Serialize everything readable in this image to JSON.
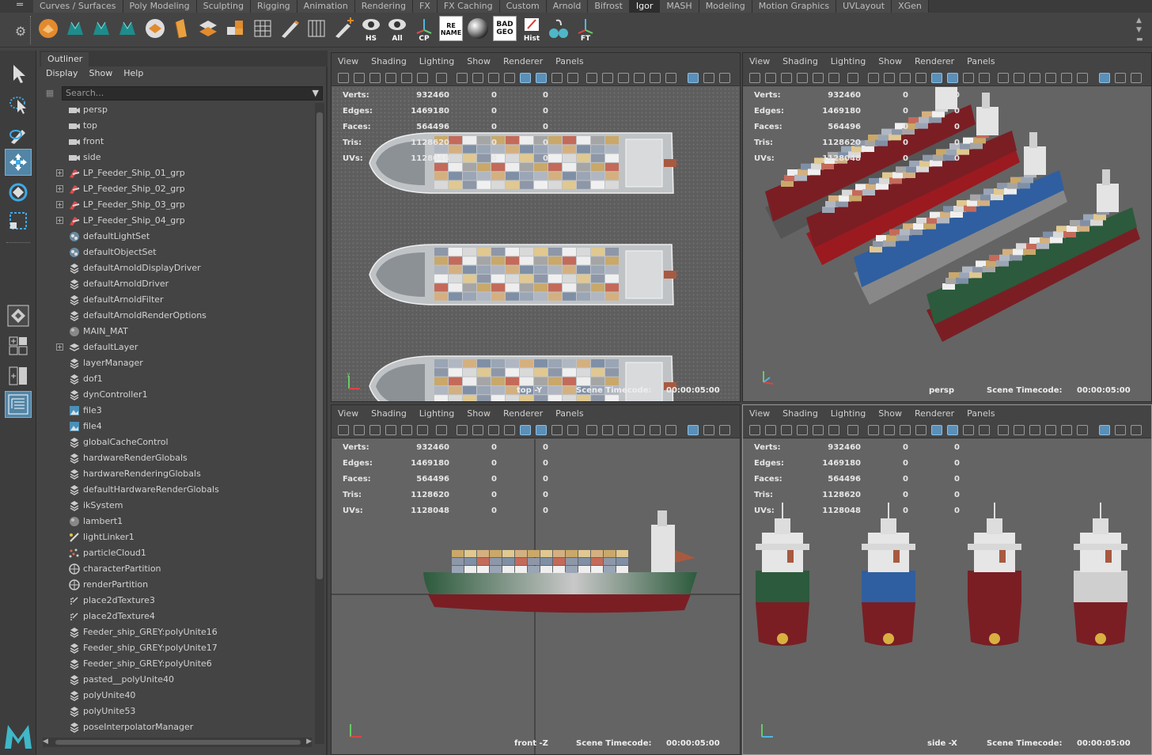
{
  "shelf": {
    "tabs": [
      "Curves / Surfaces",
      "Poly Modeling",
      "Sculpting",
      "Rigging",
      "Animation",
      "Rendering",
      "FX",
      "FX Caching",
      "Custom",
      "Arnold",
      "Bifrost",
      "Igor",
      "MASH",
      "Modeling",
      "Motion Graphics",
      "UVLayout",
      "XGen"
    ],
    "active_tab": "Igor",
    "buttons": [
      {
        "name": "shelf-icon-1",
        "label": ""
      },
      {
        "name": "shelf-icon-2",
        "label": ""
      },
      {
        "name": "shelf-icon-3",
        "label": ""
      },
      {
        "name": "shelf-icon-4",
        "label": ""
      },
      {
        "name": "shelf-icon-5",
        "label": ""
      },
      {
        "name": "shelf-icon-6",
        "label": ""
      },
      {
        "name": "shelf-icon-7",
        "label": ""
      },
      {
        "name": "shelf-icon-8",
        "label": ""
      },
      {
        "name": "shelf-icon-9",
        "label": ""
      },
      {
        "name": "shelf-icon-10",
        "label": ""
      },
      {
        "name": "shelf-icon-11",
        "label": ""
      },
      {
        "name": "shelf-icon-12",
        "label": ""
      }
    ],
    "labeled": {
      "hs": "HS",
      "all": "All",
      "cp": "CP",
      "rename": "RE NAME",
      "badgeo": "BAD GEO",
      "hist": "Hist",
      "ft": "FT"
    }
  },
  "outliner": {
    "title": "Outliner",
    "menu": [
      "Display",
      "Show",
      "Help"
    ],
    "search_placeholder": "Search...",
    "items": [
      {
        "label": "persp",
        "icon": "camera",
        "expand": false
      },
      {
        "label": "top",
        "icon": "camera",
        "expand": false
      },
      {
        "label": "front",
        "icon": "camera",
        "expand": false
      },
      {
        "label": "side",
        "icon": "camera",
        "expand": false
      },
      {
        "label": "LP_Feeder_Ship_01_grp",
        "icon": "group",
        "expand": true
      },
      {
        "label": "LP_Feeder_Ship_02_grp",
        "icon": "group",
        "expand": true
      },
      {
        "label": "LP_Feeder_Ship_03_grp",
        "icon": "group",
        "expand": true
      },
      {
        "label": "LP_Feeder_Ship_04_grp",
        "icon": "group",
        "expand": true
      },
      {
        "label": "defaultLightSet",
        "icon": "set",
        "expand": false
      },
      {
        "label": "defaultObjectSet",
        "icon": "set",
        "expand": false
      },
      {
        "label": "defaultArnoldDisplayDriver",
        "icon": "node",
        "expand": false
      },
      {
        "label": "defaultArnoldDriver",
        "icon": "node",
        "expand": false
      },
      {
        "label": "defaultArnoldFilter",
        "icon": "node",
        "expand": false
      },
      {
        "label": "defaultArnoldRenderOptions",
        "icon": "node",
        "expand": false
      },
      {
        "label": "MAIN_MAT",
        "icon": "sphere",
        "expand": false
      },
      {
        "label": "defaultLayer",
        "icon": "layer",
        "expand": true
      },
      {
        "label": "layerManager",
        "icon": "node",
        "expand": false
      },
      {
        "label": "dof1",
        "icon": "node",
        "expand": false
      },
      {
        "label": "dynController1",
        "icon": "node",
        "expand": false
      },
      {
        "label": "file3",
        "icon": "file",
        "expand": false
      },
      {
        "label": "file4",
        "icon": "file",
        "expand": false
      },
      {
        "label": "globalCacheControl",
        "icon": "node",
        "expand": false
      },
      {
        "label": "hardwareRenderGlobals",
        "icon": "node",
        "expand": false
      },
      {
        "label": "hardwareRenderingGlobals",
        "icon": "node",
        "expand": false
      },
      {
        "label": "defaultHardwareRenderGlobals",
        "icon": "node",
        "expand": false
      },
      {
        "label": "ikSystem",
        "icon": "node",
        "expand": false
      },
      {
        "label": "lambert1",
        "icon": "sphere",
        "expand": false
      },
      {
        "label": "lightLinker1",
        "icon": "linker",
        "expand": false
      },
      {
        "label": "particleCloud1",
        "icon": "particle",
        "expand": false
      },
      {
        "label": "characterPartition",
        "icon": "partition",
        "expand": false
      },
      {
        "label": "renderPartition",
        "icon": "partition",
        "expand": false
      },
      {
        "label": "place2dTexture3",
        "icon": "place2d",
        "expand": false
      },
      {
        "label": "place2dTexture4",
        "icon": "place2d",
        "expand": false
      },
      {
        "label": "Feeder_ship_GREY:polyUnite16",
        "icon": "node",
        "expand": false
      },
      {
        "label": "Feeder_ship_GREY:polyUnite17",
        "icon": "node",
        "expand": false
      },
      {
        "label": "Feeder_ship_GREY:polyUnite6",
        "icon": "node",
        "expand": false
      },
      {
        "label": "pasted__polyUnite40",
        "icon": "node",
        "expand": false
      },
      {
        "label": "polyUnite40",
        "icon": "node",
        "expand": false
      },
      {
        "label": "polyUnite53",
        "icon": "node",
        "expand": false
      },
      {
        "label": "poseInterpolatorManager",
        "icon": "node",
        "expand": false
      }
    ]
  },
  "viewport_menu": [
    "View",
    "Shading",
    "Lighting",
    "Show",
    "Renderer",
    "Panels"
  ],
  "hud": {
    "labels": [
      "Verts:",
      "Edges:",
      "Faces:",
      "Tris:",
      "UVs:"
    ],
    "values": [
      "932460",
      "1469180",
      "564496",
      "1128620",
      "1128048"
    ],
    "zeros": [
      "0",
      "0"
    ]
  },
  "viewports": {
    "top": {
      "camera": "top -Y",
      "timecode_label": "Scene Timecode:",
      "timecode": "00:00:05:00"
    },
    "persp": {
      "camera": "persp",
      "timecode_label": "Scene Timecode:",
      "timecode": "00:00:05:00"
    },
    "front": {
      "camera": "front -Z",
      "timecode_label": "Scene Timecode:",
      "timecode": "00:00:05:00"
    },
    "side": {
      "camera": "side -X",
      "timecode_label": "Scene Timecode:",
      "timecode": "00:00:05:00"
    }
  },
  "colors": {
    "accent": "#5285a6",
    "hull_red": "#7a1e24",
    "hull_blue": "#2f5fa0",
    "hull_green": "#2c5a3c",
    "hull_dark": "#3b3f45"
  },
  "axis_labels": {
    "x": "x",
    "y": "y",
    "z": "z"
  }
}
